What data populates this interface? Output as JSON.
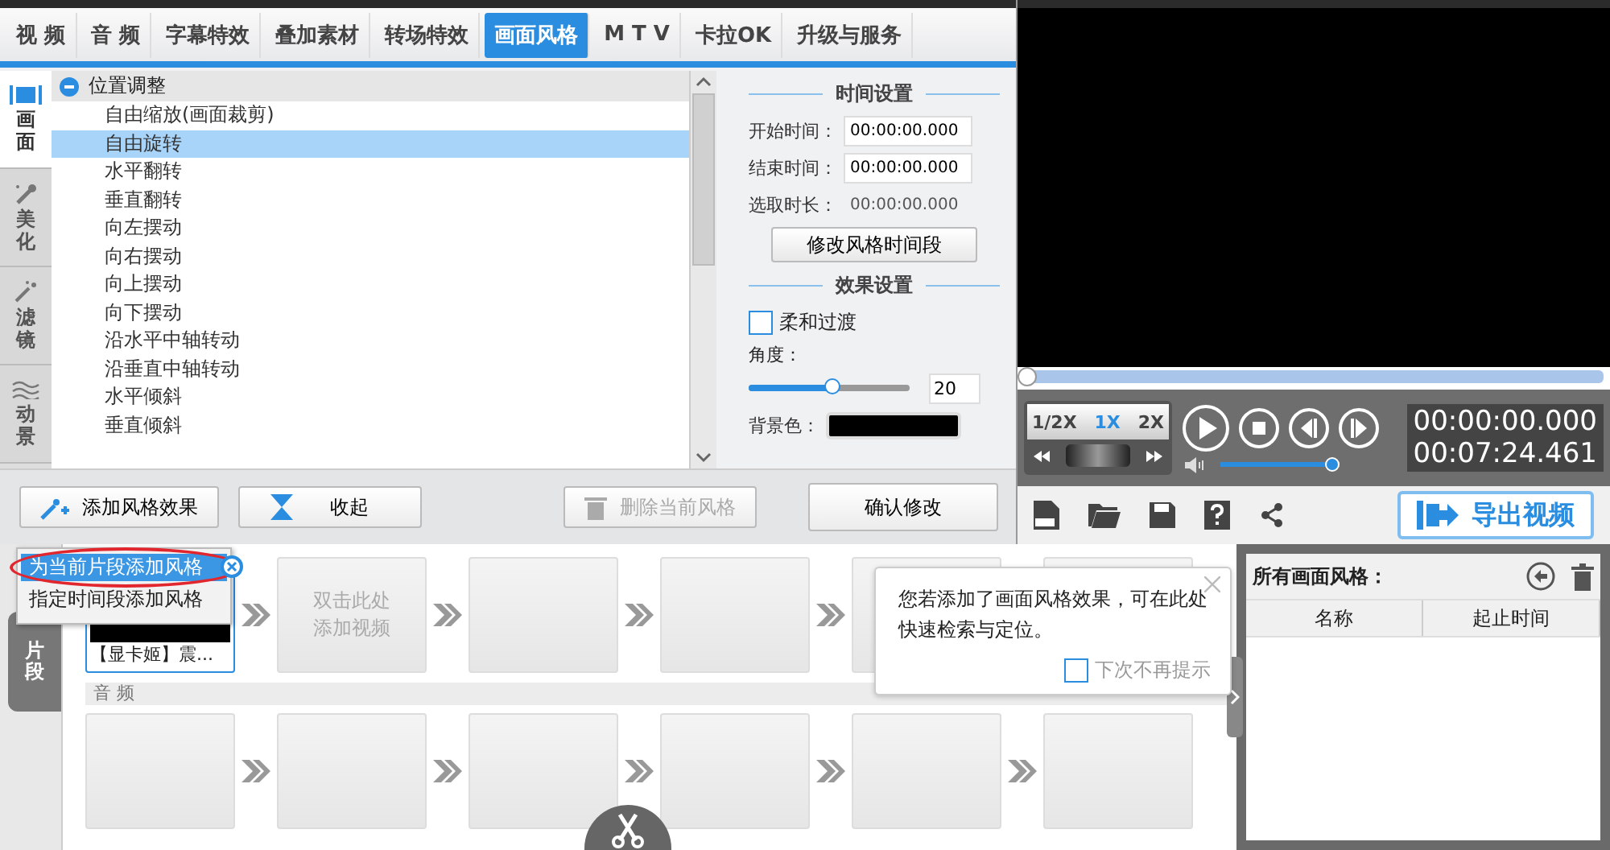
{
  "tabs": [
    {
      "label": "视 频",
      "selected": false
    },
    {
      "label": "音 频",
      "selected": false
    },
    {
      "label": "字幕特效",
      "selected": false
    },
    {
      "label": "叠加素材",
      "selected": false
    },
    {
      "label": "转场特效",
      "selected": false
    },
    {
      "label": "画面风格",
      "selected": true
    },
    {
      "label": "M T V",
      "selected": false
    },
    {
      "label": "卡拉OK",
      "selected": false
    },
    {
      "label": "升级与服务",
      "selected": false
    }
  ],
  "side_tabs": [
    {
      "label": "画面",
      "kind": "frame",
      "selected": true
    },
    {
      "label": "美化",
      "kind": "wand",
      "selected": false
    },
    {
      "label": "滤镜",
      "kind": "sparkle",
      "selected": false
    },
    {
      "label": "动景",
      "kind": "wave",
      "selected": false
    }
  ],
  "style_list": {
    "group": "位置调整",
    "expanded": true,
    "items": [
      {
        "label": "自由缩放(画面裁剪)",
        "selected": false
      },
      {
        "label": "自由旋转",
        "selected": true
      },
      {
        "label": "水平翻转",
        "selected": false
      },
      {
        "label": "垂直翻转",
        "selected": false
      },
      {
        "label": "向左摆动",
        "selected": false
      },
      {
        "label": "向右摆动",
        "selected": false
      },
      {
        "label": "向上摆动",
        "selected": false
      },
      {
        "label": "向下摆动",
        "selected": false
      },
      {
        "label": "沿水平中轴转动",
        "selected": false
      },
      {
        "label": "沿垂直中轴转动",
        "selected": false
      },
      {
        "label": "水平倾斜",
        "selected": false
      },
      {
        "label": "垂直倾斜",
        "selected": false
      }
    ]
  },
  "time_settings": {
    "title": "时间设置",
    "fields": [
      {
        "label": "开始时间：",
        "value": "00:00:00.000",
        "kind": "input"
      },
      {
        "label": "结束时间：",
        "value": "00:00:00.000",
        "kind": "input"
      },
      {
        "label": "选取时长：",
        "value": "00:00:00.000",
        "kind": "text"
      }
    ],
    "button": "修改风格时间段"
  },
  "effect_settings": {
    "title": "效果设置",
    "soft_transition": {
      "label": "柔和过渡",
      "checked": false
    },
    "angle": {
      "label": "角度：",
      "level": 0.52,
      "value": "20"
    },
    "background": {
      "label": "背景色："
    }
  },
  "buttons": [
    {
      "label": "添加风格效果",
      "kind": "add",
      "disabled": false
    },
    {
      "label": "收起",
      "kind": "collapse",
      "disabled": false
    },
    {
      "label": "删除当前风格",
      "kind": "delete",
      "disabled": true
    }
  ],
  "confirm_button": "确认修改",
  "popup_menu": [
    {
      "label": "为当前片段添加风格",
      "selected": true
    },
    {
      "label": "指定时间段添加风格",
      "selected": false
    }
  ],
  "player": {
    "seek": {
      "level": 0
    },
    "speeds": [
      {
        "label": "1/2X",
        "selected": false
      },
      {
        "label": "1X",
        "selected": true
      },
      {
        "label": "2X",
        "selected": false
      }
    ],
    "times": [
      "00:00:00.000",
      "00:07:24.461"
    ],
    "volume": {
      "level": 0.93
    },
    "export_button": "导出视频"
  },
  "timeline": {
    "side_tab": "片段",
    "clips": [
      {
        "kind": "clip",
        "title": "【显卡姬】震..."
      },
      {
        "kind": "placeholder",
        "lines": [
          "双击此处",
          "添加视频"
        ]
      },
      {
        "kind": "empty"
      },
      {
        "kind": "empty"
      },
      {
        "kind": "empty"
      },
      {
        "kind": "empty"
      }
    ],
    "audio_label": "音 频"
  },
  "tip": {
    "text": "您若添加了画面风格效果，可在此处快速检索与定位。",
    "checkbox": {
      "label": "下次不再提示",
      "checked": false
    }
  },
  "styles_panel": {
    "title": "所有画面风格：",
    "columns": [
      "名称",
      "起止时间"
    ]
  }
}
